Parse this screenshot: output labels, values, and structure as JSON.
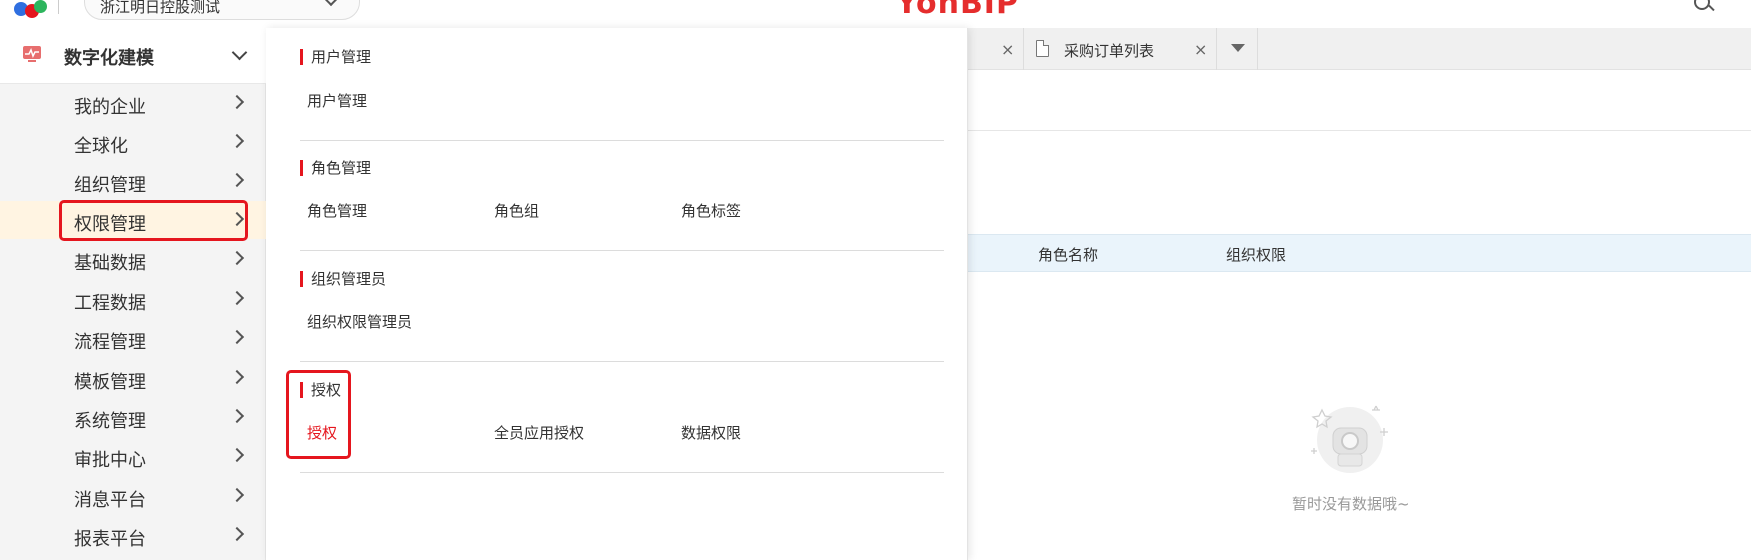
{
  "header": {
    "tenant_name": "浙江明日控股测试",
    "brand": "YonBIP"
  },
  "tabs": {
    "items": [
      {
        "label": "采购订单列表"
      }
    ]
  },
  "table": {
    "columns": [
      "角色名称",
      "组织权限"
    ],
    "empty_text": "暂时没有数据哦~"
  },
  "sidebar": {
    "title": "数字化建模",
    "items": [
      {
        "label": "我的企业"
      },
      {
        "label": "全球化"
      },
      {
        "label": "组织管理"
      },
      {
        "label": "权限管理",
        "active": true
      },
      {
        "label": "基础数据"
      },
      {
        "label": "工程数据"
      },
      {
        "label": "流程管理"
      },
      {
        "label": "模板管理"
      },
      {
        "label": "系统管理"
      },
      {
        "label": "审批中心"
      },
      {
        "label": "消息平台"
      },
      {
        "label": "报表平台"
      }
    ]
  },
  "menu": {
    "sections": [
      {
        "title": "用户管理",
        "links": [
          "用户管理"
        ]
      },
      {
        "title": "角色管理",
        "links": [
          "角色管理",
          "角色组",
          "角色标签"
        ]
      },
      {
        "title": "组织管理员",
        "links": [
          "组织权限管理员"
        ]
      },
      {
        "title": "授权",
        "links": [
          "授权",
          "全员应用授权",
          "数据权限"
        ]
      }
    ]
  },
  "colors": {
    "accent_red": "#e5161e",
    "active_row_bg": "#fff4e2",
    "table_head_bg": "#eaf4fb"
  }
}
